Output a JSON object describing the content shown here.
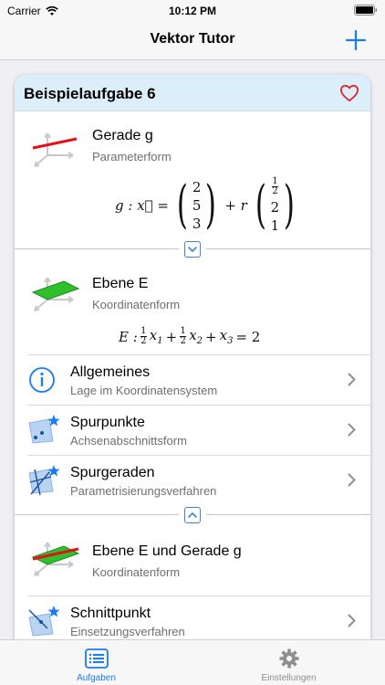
{
  "status": {
    "carrier": "Carrier",
    "time": "10:12 PM"
  },
  "nav": {
    "title": "Vektor Tutor"
  },
  "card": {
    "title": "Beispielaufgabe 6",
    "line": {
      "title": "Gerade g",
      "subtitle": "Parameterform",
      "formula": {
        "lhs": "g : x⃗ =",
        "support": [
          "2",
          "5",
          "3"
        ],
        "mid": "+ r",
        "direction_top": "2",
        "direction": [
          "2",
          "1"
        ],
        "frac_num": "1",
        "frac_den": "2"
      }
    },
    "plane": {
      "title": "Ebene E",
      "subtitle": "Koordinatenform",
      "formula": {
        "lhs": "E :",
        "t1_num": "1",
        "t1_den": "2",
        "t1_var": "x",
        "t1_idx": "1",
        "plus1": "+",
        "t2_num": "1",
        "t2_den": "2",
        "t2_var": "x",
        "t2_idx": "2",
        "plus2": "+",
        "t3_var": "x",
        "t3_idx": "3",
        "rhs": "= 2"
      }
    },
    "rows": [
      {
        "title": "Allgemeines",
        "subtitle": "Lage im Koordinatensystem"
      },
      {
        "title": "Spurpunkte",
        "subtitle": "Achsenabschnittsform"
      },
      {
        "title": "Spurgeraden",
        "subtitle": "Parametrisierungsverfahren"
      }
    ],
    "combo": {
      "title": "Ebene E und Gerade g",
      "subtitle": "Koordinatenform"
    },
    "intersection": {
      "title": "Schnittpunkt",
      "subtitle": "Einsetzungsverfahren"
    }
  },
  "tabs": [
    {
      "label": "Aufgaben",
      "active": true
    },
    {
      "label": "Einstellungen",
      "active": false
    }
  ],
  "colors": {
    "accent": "#1a7cf2",
    "header_bg": "#ddeefb",
    "line_red": "#e4111a",
    "plane_green": "#2fc12c",
    "heart": "#e0262c"
  }
}
